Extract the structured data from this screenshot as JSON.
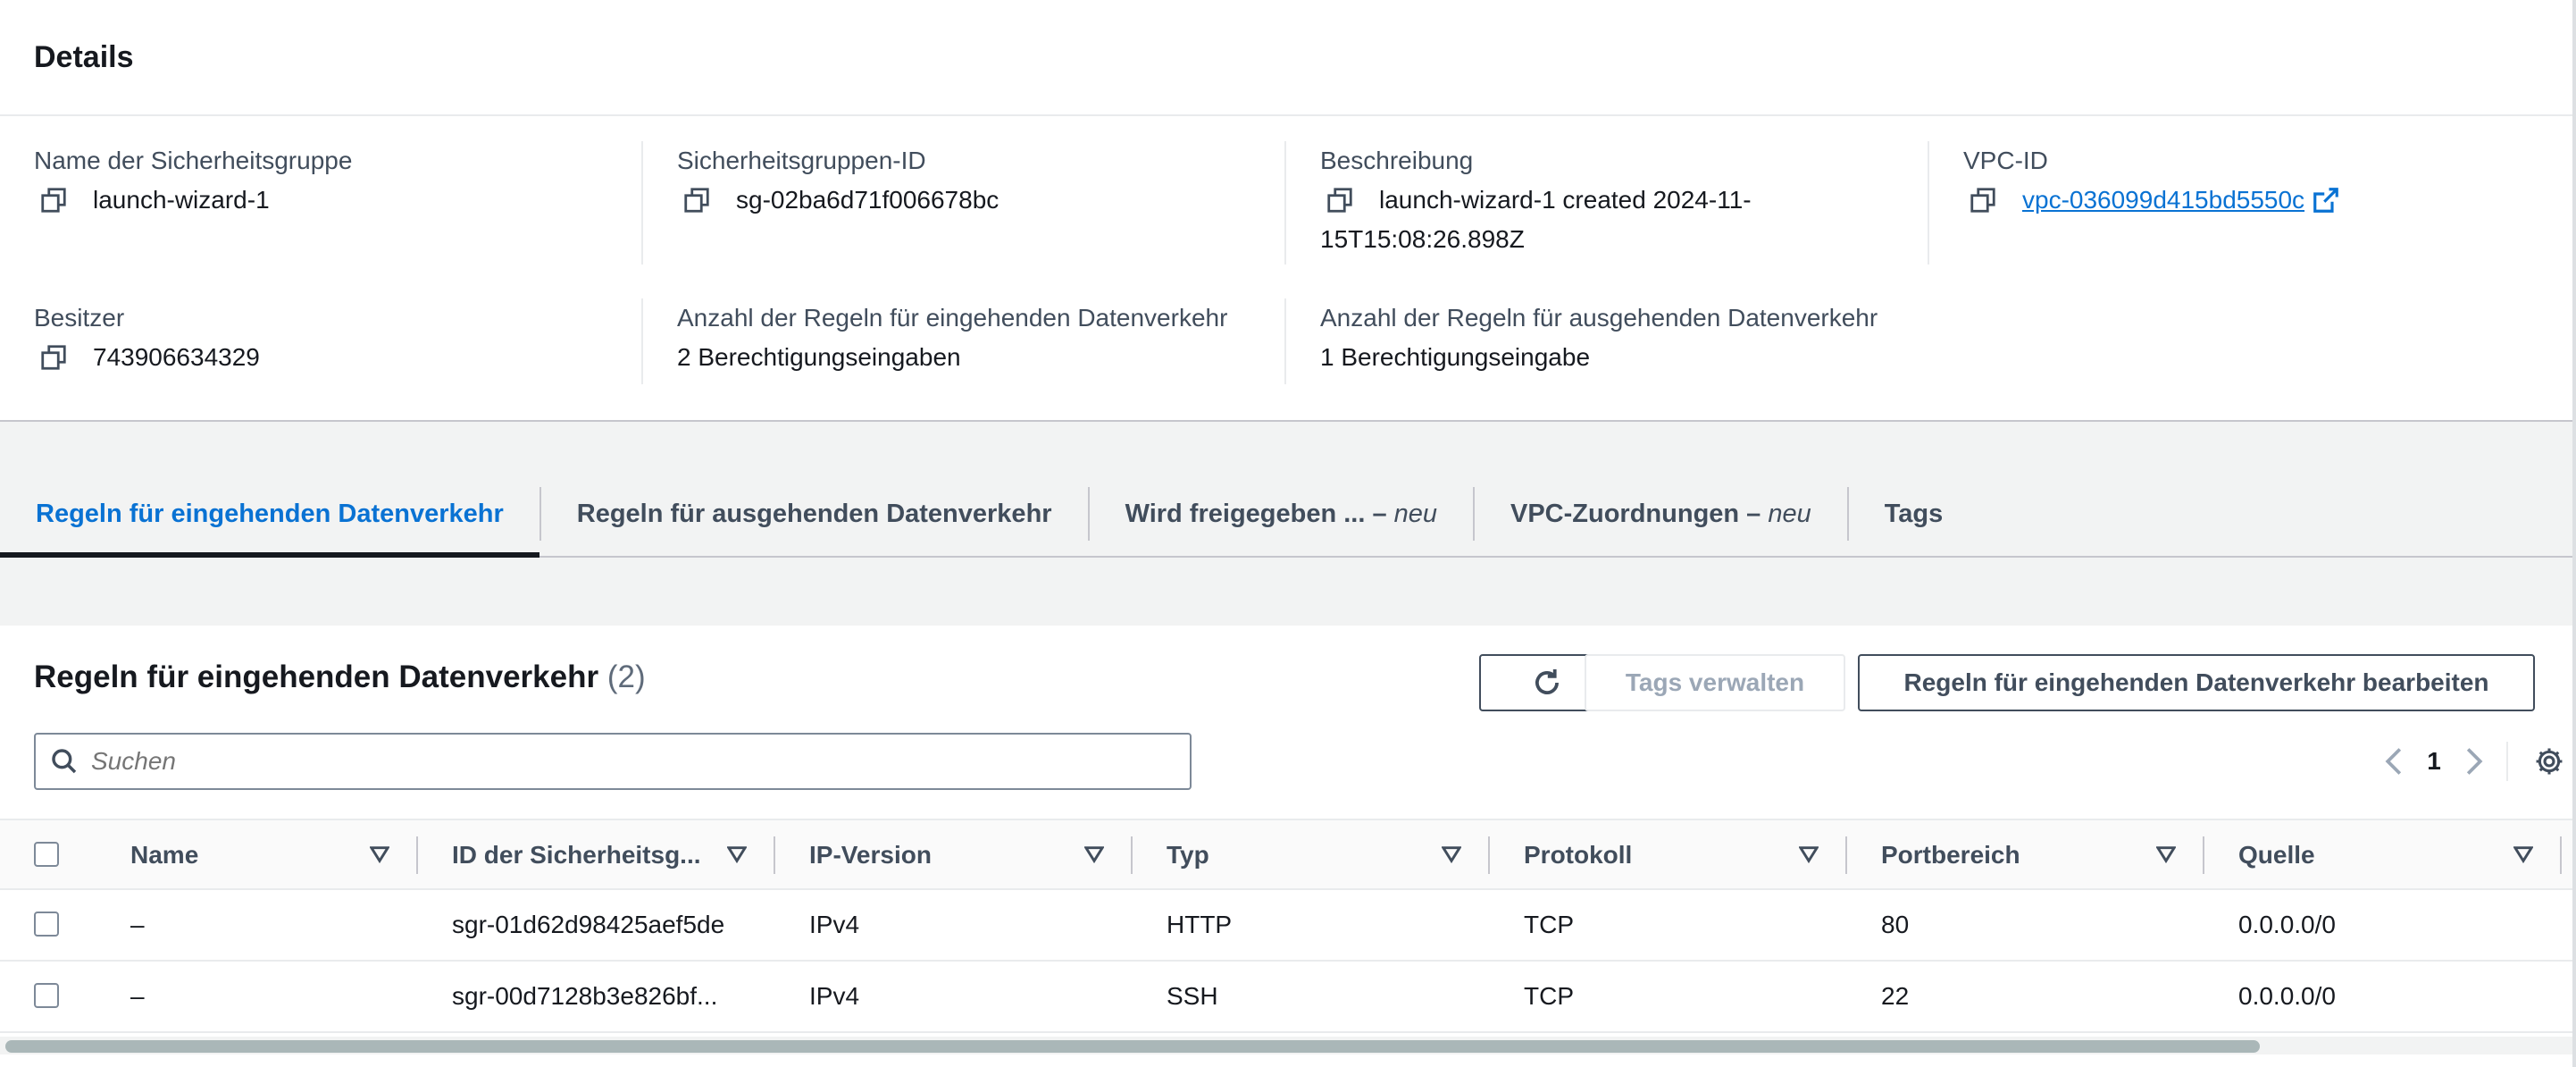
{
  "details": {
    "title": "Details",
    "name_label": "Name der Sicherheitsgruppe",
    "name_value": "launch-wizard-1",
    "sgid_label": "Sicherheitsgruppen-ID",
    "sgid_value": "sg-02ba6d71f006678bc",
    "desc_label": "Beschreibung",
    "desc_value": "launch-wizard-1 created 2024-11-15T15:08:26.898Z",
    "vpc_label": "VPC-ID",
    "vpc_value": "vpc-036099d415bd5550c",
    "owner_label": "Besitzer",
    "owner_value": "743906634329",
    "inbound_count_label": "Anzahl der Regeln für eingehenden Datenverkehr",
    "inbound_count_value": "2 Berechtigungseingaben",
    "outbound_count_label": "Anzahl der Regeln für ausgehenden Datenverkehr",
    "outbound_count_value": "1 Berechtigungseingabe"
  },
  "tabs": [
    {
      "label": "Regeln für eingehenden Datenverkehr",
      "suffix": ""
    },
    {
      "label": "Regeln für ausgehenden Datenverkehr",
      "suffix": ""
    },
    {
      "label": "Wird freigegeben ... –",
      "suffix": "neu"
    },
    {
      "label": "VPC-Zuordnungen –",
      "suffix": "neu"
    },
    {
      "label": "Tags",
      "suffix": ""
    }
  ],
  "rules": {
    "title": "Regeln für eingehenden Datenverkehr",
    "count": "(2)",
    "manage_tags_label": "Tags verwalten",
    "edit_label": "Regeln für eingehenden Datenverkehr bearbeiten",
    "search_placeholder": "Suchen",
    "page": "1",
    "columns": [
      "Name",
      "ID der Sicherheitsg...",
      "IP-Version",
      "Typ",
      "Protokoll",
      "Portbereich",
      "Quelle"
    ],
    "rows": [
      {
        "name": "–",
        "id": "sgr-01d62d98425aef5de",
        "ipv": "IPv4",
        "type": "HTTP",
        "protocol": "TCP",
        "port": "80",
        "source": "0.0.0.0/0"
      },
      {
        "name": "–",
        "id": "sgr-00d7128b3e826bf...",
        "ipv": "IPv4",
        "type": "SSH",
        "protocol": "TCP",
        "port": "22",
        "source": "0.0.0.0/0"
      }
    ]
  },
  "colors": {
    "accent": "#0972d3",
    "text": "#16191f",
    "secondary": "#414d5c"
  }
}
